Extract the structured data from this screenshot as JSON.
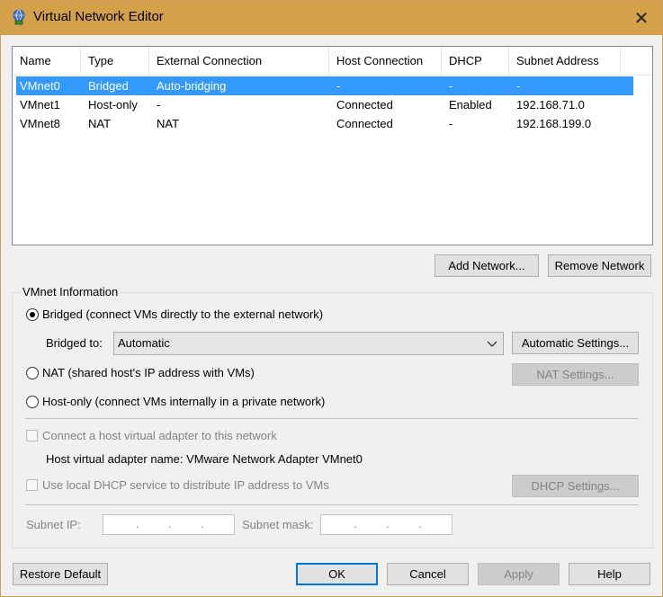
{
  "window": {
    "title": "Virtual Network Editor",
    "close_glyph": "✕"
  },
  "list": {
    "columns": [
      "Name",
      "Type",
      "External Connection",
      "Host Connection",
      "DHCP",
      "Subnet Address"
    ],
    "rows": [
      {
        "name": "VMnet0",
        "type": "Bridged",
        "external": "Auto-bridging",
        "host": "-",
        "dhcp": "-",
        "subnet": "-",
        "selected": true
      },
      {
        "name": "VMnet1",
        "type": "Host-only",
        "external": "-",
        "host": "Connected",
        "dhcp": "Enabled",
        "subnet": "192.168.71.0",
        "selected": false
      },
      {
        "name": "VMnet8",
        "type": "NAT",
        "external": "NAT",
        "host": "Connected",
        "dhcp": "-",
        "subnet": "192.168.199.0",
        "selected": false
      }
    ]
  },
  "buttons": {
    "add_network": "Add Network...",
    "remove_network": "Remove Network",
    "automatic_settings": "Automatic Settings...",
    "nat_settings": "NAT Settings...",
    "dhcp_settings": "DHCP Settings...",
    "restore_default": "Restore Default",
    "ok": "OK",
    "cancel": "Cancel",
    "apply": "Apply",
    "help": "Help"
  },
  "vmnet_info": {
    "group_label": "VMnet Information",
    "bridged_label": "Bridged (connect VMs directly to the external network)",
    "bridged_to_label": "Bridged to:",
    "bridged_to_value": "Automatic",
    "nat_label": "NAT (shared host's IP address with VMs)",
    "hostonly_label": "Host-only (connect VMs internally in a private network)",
    "connect_adapter_label": "Connect a host virtual adapter to this network",
    "adapter_name_label": "Host virtual adapter name: VMware Network Adapter VMnet0",
    "use_dhcp_label": "Use local DHCP service to distribute IP address to VMs",
    "subnet_ip_label": "Subnet IP:",
    "subnet_mask_label": "Subnet mask:",
    "selected_mode": "bridged"
  },
  "colors": {
    "titlebar": "#d5a04a",
    "selection": "#3399ff",
    "default_button_border": "#0078d7"
  }
}
